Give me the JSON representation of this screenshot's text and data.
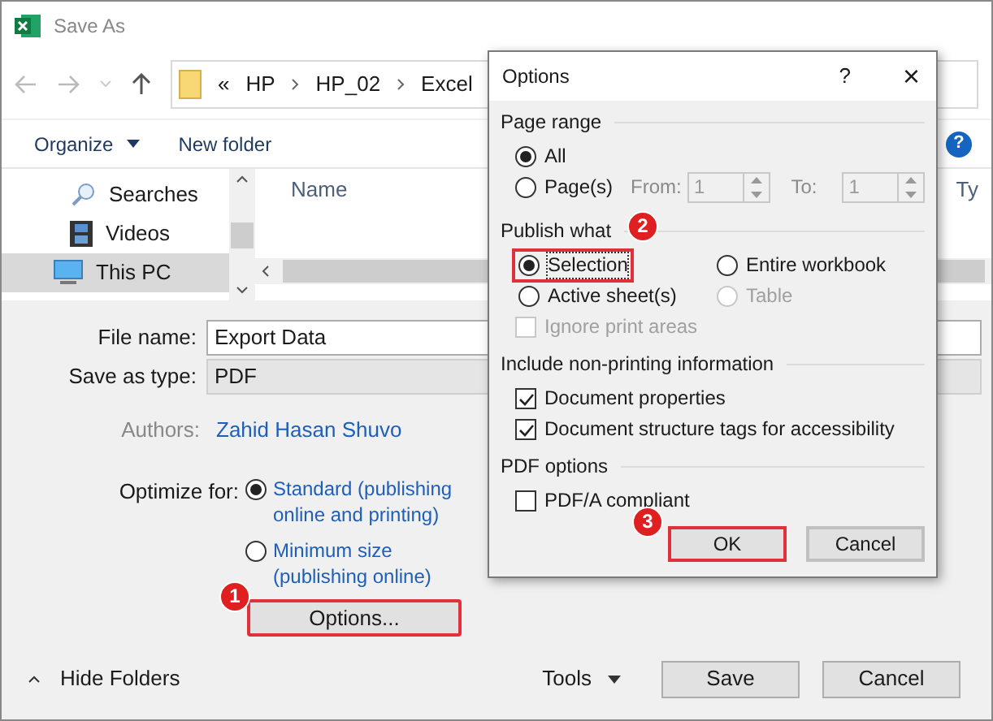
{
  "window": {
    "title": "Save As"
  },
  "address_bar": {
    "overflow": "«",
    "path": [
      "HP",
      "HP_02",
      "Excel"
    ]
  },
  "toolbar": {
    "organize": "Organize",
    "new_folder": "New folder",
    "help": "?"
  },
  "nav_tree": [
    {
      "label": "Searches",
      "kind": "search",
      "selected": false
    },
    {
      "label": "Videos",
      "kind": "film",
      "selected": false
    },
    {
      "label": "This PC",
      "kind": "monitor",
      "selected": true
    }
  ],
  "file_list": {
    "columns": [
      "Name",
      "Ty"
    ]
  },
  "fields": [
    {
      "label": "File name:",
      "value": "Export Data",
      "kind": "text"
    },
    {
      "label": "Save as type:",
      "value": "PDF",
      "kind": "dropdown"
    }
  ],
  "authors": {
    "label": "Authors:",
    "value": "Zahid Hasan Shuvo"
  },
  "optimize": {
    "label": "Optimize for:",
    "options": [
      {
        "label": "Standard (publishing online and printing)",
        "selected": true
      },
      {
        "label": "Minimum size (publishing online)",
        "selected": false
      }
    ]
  },
  "options_button": {
    "label": "Options...",
    "highlighted": true,
    "badge": "1"
  },
  "footer": {
    "hide_folders": "Hide Folders",
    "tools": "Tools",
    "buttons": [
      "Save",
      "Cancel"
    ]
  },
  "options_dialog": {
    "title": "Options",
    "help": "?",
    "close": "×",
    "page_range": {
      "title": "Page range",
      "options": [
        {
          "label": "All",
          "selected": true
        },
        {
          "label": "Page(s)",
          "selected": false
        }
      ],
      "from": {
        "label": "From:",
        "value": "1"
      },
      "to": {
        "label": "To:",
        "value": "1"
      },
      "disabled": true
    },
    "publish_what": {
      "title": "Publish what",
      "badge": "2",
      "options": [
        {
          "label": "Selection",
          "selected": true,
          "disabled": false,
          "highlighted": true
        },
        {
          "label": "Entire workbook",
          "selected": false,
          "disabled": false,
          "highlighted": false
        },
        {
          "label": "Active sheet(s)",
          "selected": false,
          "disabled": false,
          "highlighted": false
        },
        {
          "label": "Table",
          "selected": false,
          "disabled": true,
          "highlighted": false
        }
      ],
      "ignore_print_areas": {
        "label": "Ignore print areas",
        "checked": false,
        "disabled": true
      }
    },
    "non_printing": {
      "title": "Include non-printing information",
      "checkboxes": [
        {
          "label": "Document properties",
          "checked": true
        },
        {
          "label": "Document structure tags for accessibility",
          "checked": true
        }
      ]
    },
    "pdf_options": {
      "title": "PDF options",
      "checkboxes": [
        {
          "label": "PDF/A compliant",
          "checked": false
        }
      ]
    },
    "buttons": [
      {
        "label": "OK",
        "highlighted": true,
        "badge": "3"
      },
      {
        "label": "Cancel",
        "highlighted": false
      }
    ]
  }
}
